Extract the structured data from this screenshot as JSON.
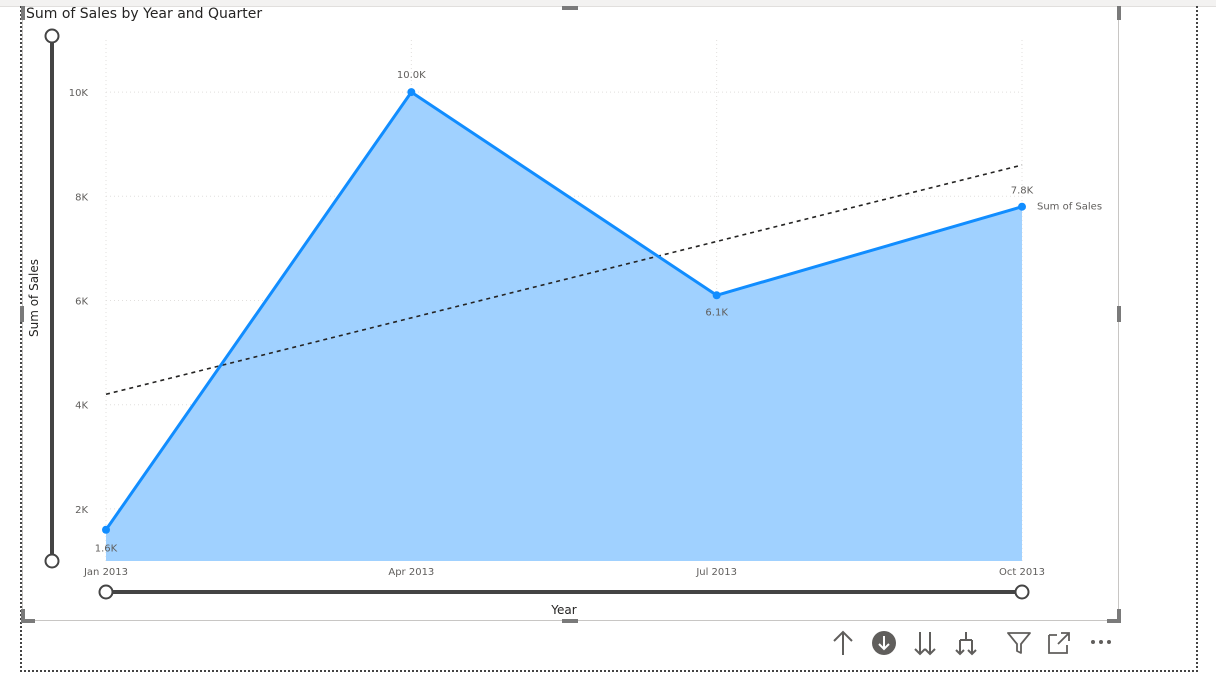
{
  "chart_title": "Sum of Sales by Year and Quarter",
  "chart_data": {
    "type": "area",
    "title": "Sum of Sales by Year and Quarter",
    "xlabel": "Year",
    "ylabel": "Sum of Sales",
    "categories": [
      "Jan 2013",
      "Apr 2013",
      "Jul 2013",
      "Oct 2013"
    ],
    "series": [
      {
        "name": "Sum of Sales",
        "values": [
          1600,
          10000,
          6100,
          7800
        ],
        "labels": [
          "1.6K",
          "10.0K",
          "6.1K",
          "7.8K"
        ],
        "color": "#118DFF",
        "fill": "#A0D1FF"
      }
    ],
    "trend_line": {
      "style": "dotted",
      "color": "#252423",
      "start": 4200,
      "end": 8600
    },
    "y_ticks": [
      2000,
      4000,
      6000,
      8000,
      10000
    ],
    "y_tick_labels": [
      "2K",
      "4K",
      "6K",
      "8K",
      "10K"
    ],
    "ylim": [
      1000,
      11000
    ],
    "grid": true,
    "legend": "end-of-line label"
  },
  "toolbar": {
    "icons": [
      "drill-up-icon",
      "drill-down-toggle-icon",
      "next-level-icon",
      "expand-hierarchy-icon",
      "filter-icon",
      "focus-mode-icon",
      "more-options-icon"
    ]
  }
}
